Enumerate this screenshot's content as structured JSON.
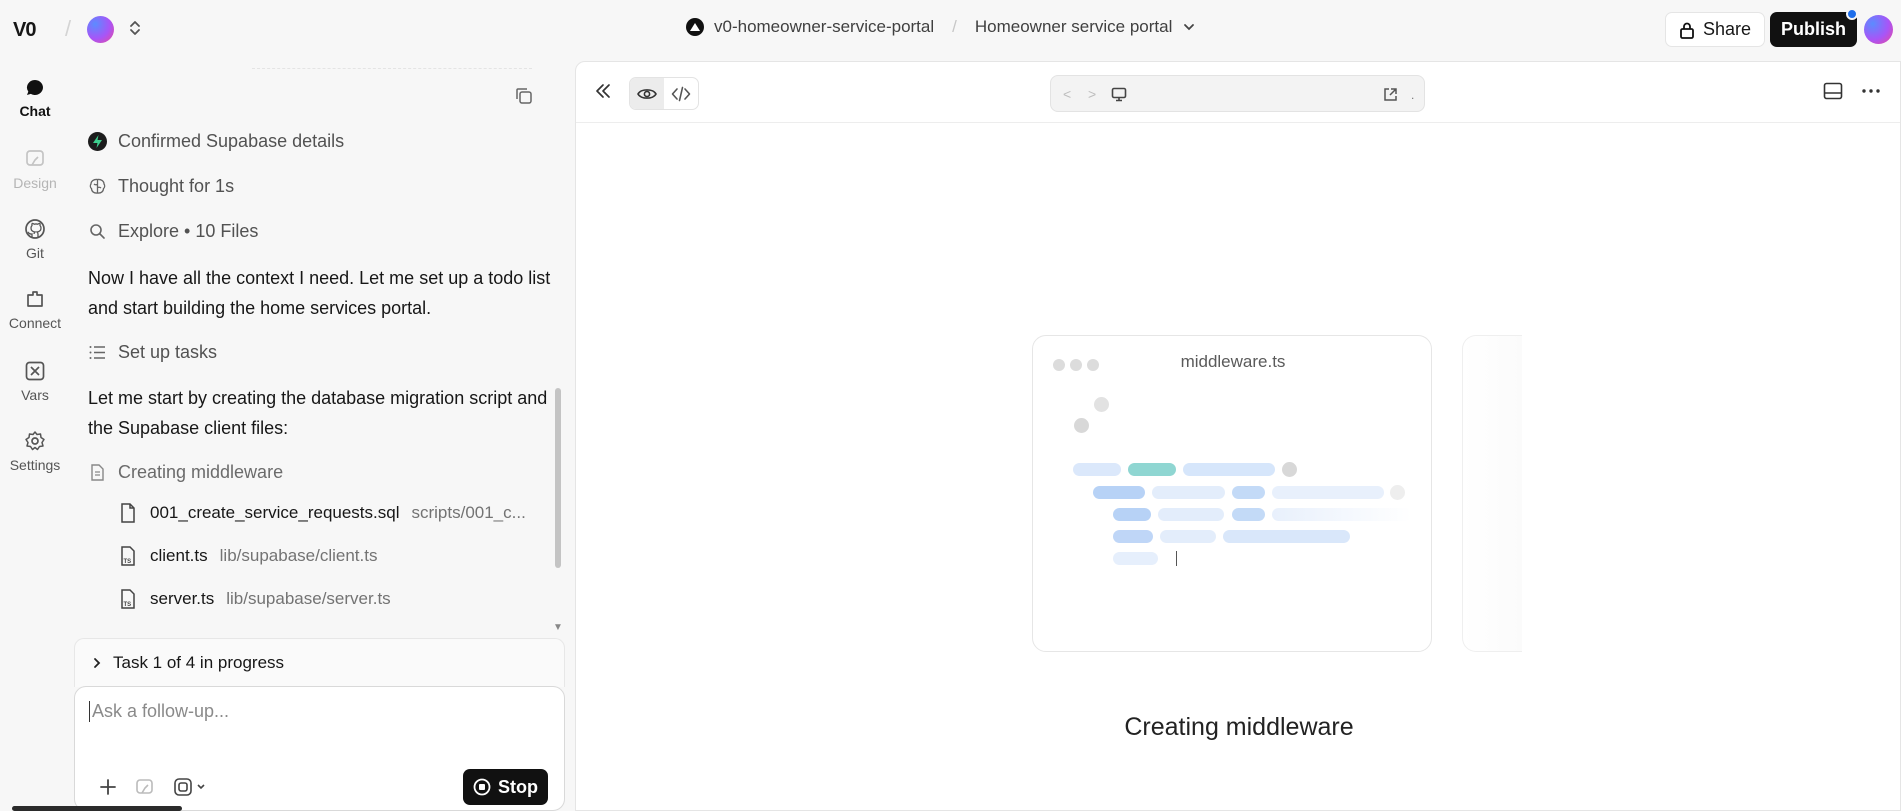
{
  "topbar": {
    "logo": "V0",
    "project_name": "v0-homeowner-service-portal",
    "page_name": "Homeowner service portal",
    "share_label": "Share",
    "publish_label": "Publish"
  },
  "rail": {
    "items": [
      {
        "label": "Chat",
        "icon": "chat-bubble-icon",
        "state": "active"
      },
      {
        "label": "Design",
        "icon": "design-icon",
        "state": "disabled"
      },
      {
        "label": "Git",
        "icon": "github-icon",
        "state": "normal"
      },
      {
        "label": "Connect",
        "icon": "connect-icon",
        "state": "normal"
      },
      {
        "label": "Vars",
        "icon": "variable-icon",
        "state": "normal"
      },
      {
        "label": "Settings",
        "icon": "gear-icon",
        "state": "normal"
      }
    ]
  },
  "chat": {
    "steps": [
      {
        "text": "Confirmed Supabase details",
        "icon": "supabase-icon"
      },
      {
        "text": "Thought for 1s",
        "icon": "brain-icon"
      },
      {
        "text": "Explore • 10 Files",
        "icon": "search-icon"
      }
    ],
    "message_1": "Now I have all the context I need. Let me set up a todo list and start building the home services portal.",
    "step_tasks": "Set up tasks",
    "message_2": "Let me start by creating the database migration script and the Supabase client files:",
    "step_middleware": "Creating middleware",
    "files": [
      {
        "name": "001_create_service_requests.sql",
        "path": "scripts/001_c...",
        "icon": "file-icon"
      },
      {
        "name": "client.ts",
        "path": "lib/supabase/client.ts",
        "icon": "ts-file-icon"
      },
      {
        "name": "server.ts",
        "path": "lib/supabase/server.ts",
        "icon": "ts-file-icon"
      }
    ],
    "task_status": "Task 1 of 4 in progress",
    "composer_placeholder": "Ask a follow-up...",
    "stop_label": "Stop"
  },
  "preview": {
    "card_filename": "middleware.ts",
    "caption": "Creating middleware",
    "url_value": ""
  },
  "colors": {
    "accent_blue": "#1f6feb",
    "dark_button": "#111111",
    "supabase_green": "#3ecf8e"
  }
}
